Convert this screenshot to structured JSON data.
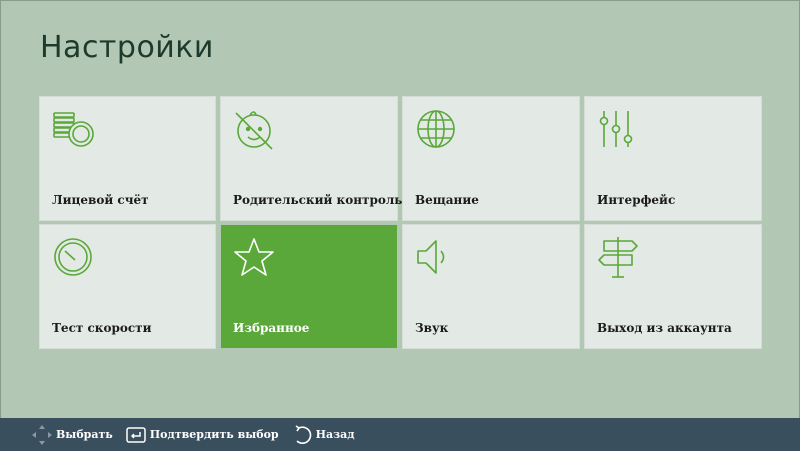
{
  "page": {
    "title": "Настройки"
  },
  "tiles": [
    {
      "label": "Лицевой счёт",
      "icon": "coins-icon",
      "selected": false
    },
    {
      "label": "Родительский контроль",
      "icon": "child-face-crossed-icon",
      "selected": false
    },
    {
      "label": "Вещание",
      "icon": "globe-icon",
      "selected": false
    },
    {
      "label": "Интерфейс",
      "icon": "sliders-icon",
      "selected": false
    },
    {
      "label": "Тест скорости",
      "icon": "speedometer-icon",
      "selected": false
    },
    {
      "label": "Избранное",
      "icon": "star-icon",
      "selected": true
    },
    {
      "label": "Звук",
      "icon": "speaker-icon",
      "selected": false
    },
    {
      "label": "Выход из аккаунта",
      "icon": "signpost-icon",
      "selected": false
    }
  ],
  "bottom_bar": {
    "hints": [
      {
        "label": "Выбрать",
        "icon": "dpad-arrows-icon"
      },
      {
        "label": "Подтвердить выбор",
        "icon": "enter-key-icon"
      },
      {
        "label": "Назад",
        "icon": "back-arrow-icon"
      }
    ]
  },
  "colors": {
    "background": "#b3c8b4",
    "tile": "#e3e9e4",
    "accent": "#5aa83a",
    "icon_stroke": "#5aa83a",
    "bottom_bar": "#3a4f5d",
    "title": "#1e3a2c"
  }
}
